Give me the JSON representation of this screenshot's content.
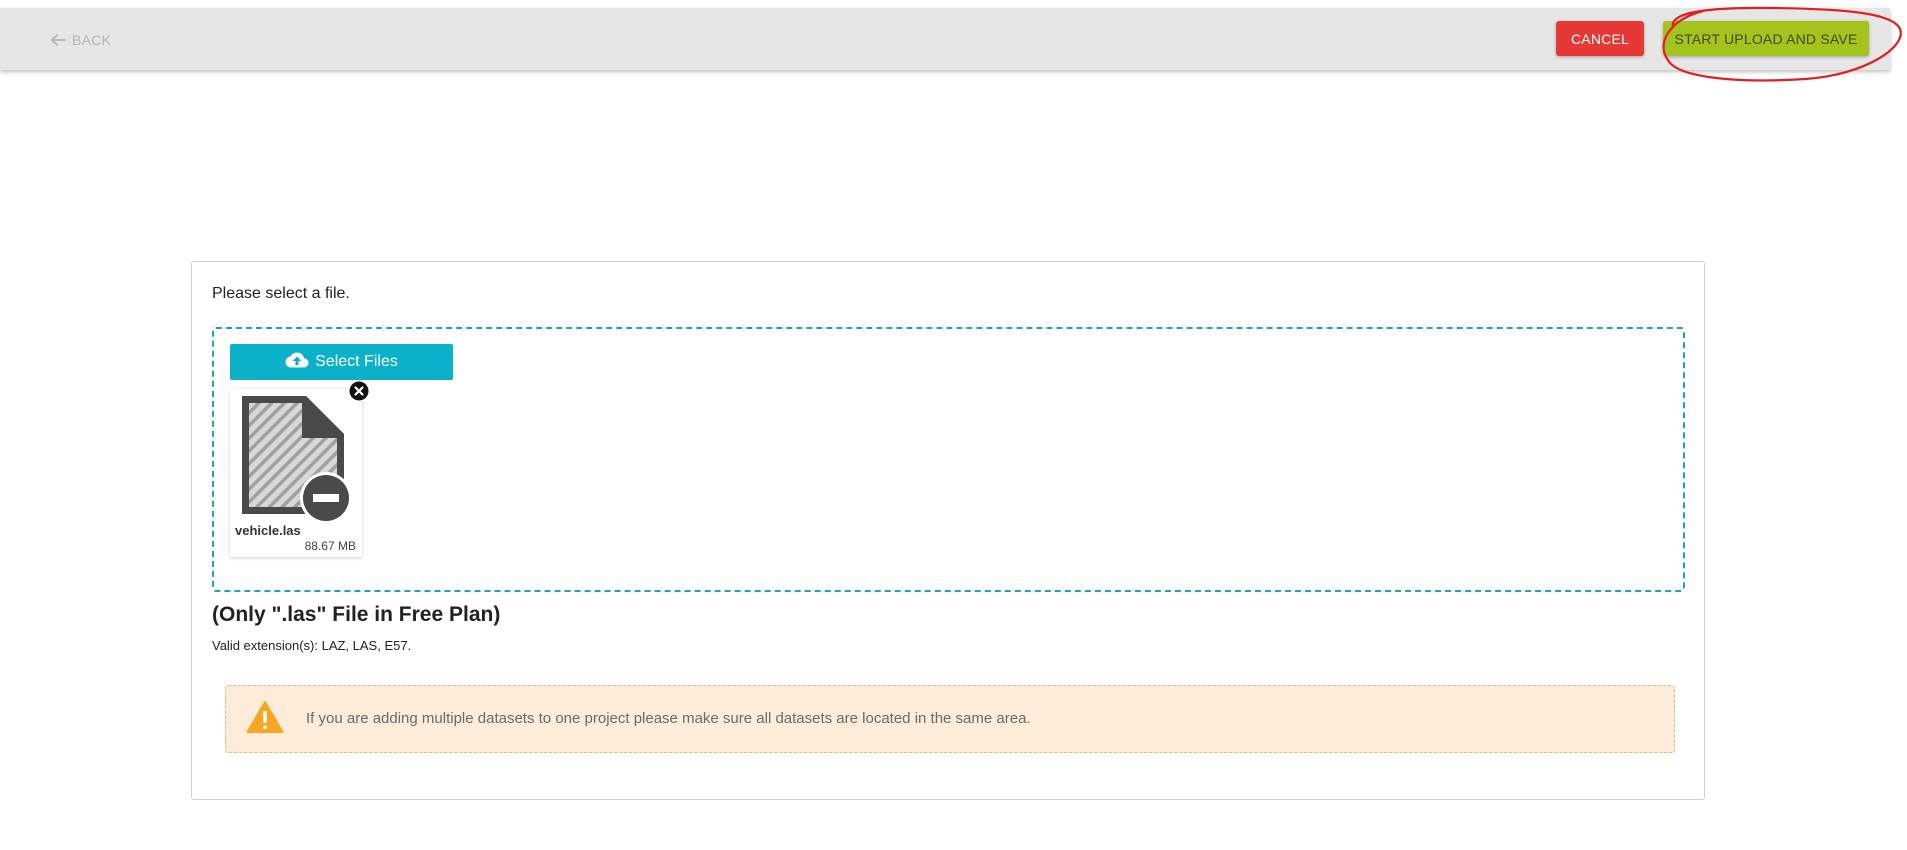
{
  "toolbar": {
    "back_label": "BACK",
    "cancel_label": "CANCEL",
    "upload_label": "START UPLOAD AND SAVE"
  },
  "upload": {
    "prompt": "Please select a file.",
    "select_button_label": "Select Files",
    "files": [
      {
        "name": "vehicle.las",
        "size": "88.67 MB"
      }
    ],
    "plan_note": "(Only \".las\" File in Free Plan)",
    "valid_extensions": "Valid extension(s): LAZ, LAS, E57."
  },
  "warning": {
    "text": "If you are adding multiple datasets to one project please make sure all datasets are located in the same area."
  },
  "colors": {
    "cancel": "#e53935",
    "upload": "#a4c41d",
    "select_files": "#0ab1c9",
    "dropzone_border": "#1aa7b5",
    "warning_bg": "#fcecd9",
    "warning_icon": "#f6a623",
    "annotation_ring": "#e02020"
  }
}
